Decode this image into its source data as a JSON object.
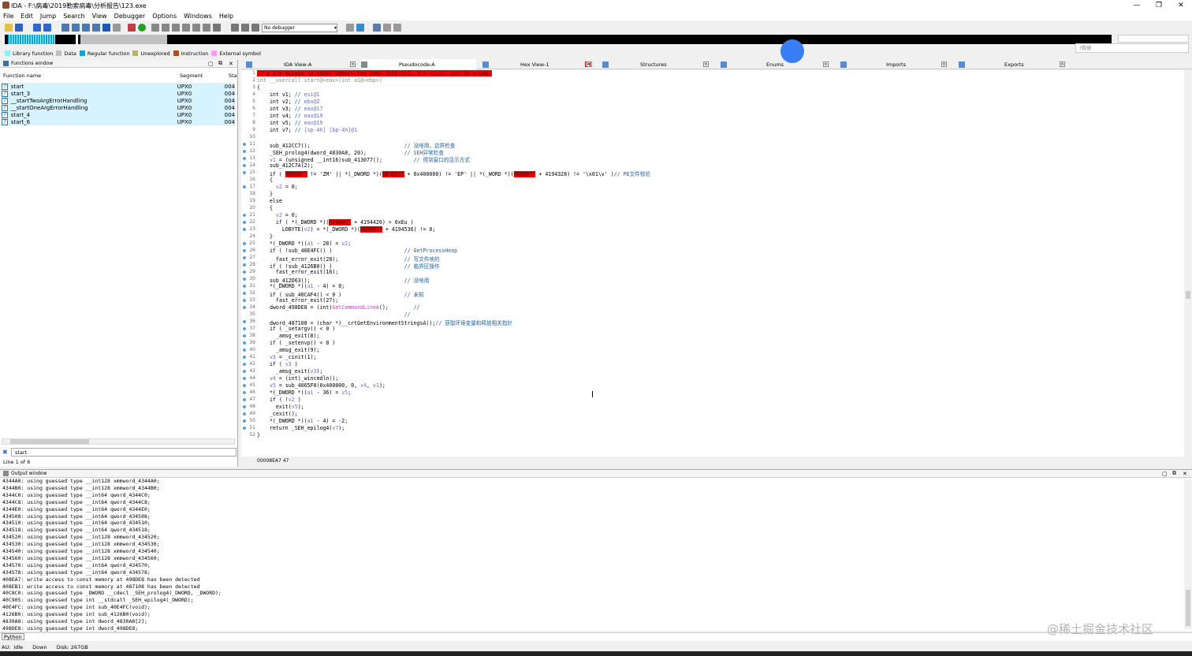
{
  "window": {
    "title": "IDA - F:\\病毒\\2019勒索病毒\\分析报告\\123.exe"
  },
  "menu": [
    "File",
    "Edit",
    "Jump",
    "Search",
    "View",
    "Debugger",
    "Options",
    "Windows",
    "Help"
  ],
  "toolbar": {
    "debugger_select": "No debugger"
  },
  "legend": [
    {
      "label": "Library function",
      "color": "#8ff0f0"
    },
    {
      "label": "Data",
      "color": "#c0c0c0"
    },
    {
      "label": "Regular function",
      "color": "#0aa5dc"
    },
    {
      "label": "Unexplored",
      "color": "#b4b478"
    },
    {
      "label": "Instruction",
      "color": "#a0522d"
    },
    {
      "label": "External symbol",
      "color": "#ff9ff0"
    }
  ],
  "popup_text": "?数据",
  "functions_window": {
    "title": "Functions window",
    "columns": [
      "Function name",
      "Segment",
      "Sta"
    ],
    "rows": [
      {
        "name": "start",
        "segment": "UPX0",
        "start": "004"
      },
      {
        "name": "start_3",
        "segment": "UPX0",
        "start": "004"
      },
      {
        "name": "__startTwoArgErrorHandling",
        "segment": "UPX0",
        "start": "004"
      },
      {
        "name": "__startOneArgErrorHandling",
        "segment": "UPX0",
        "start": "004"
      },
      {
        "name": "start_4",
        "segment": "UPX0",
        "start": "004"
      },
      {
        "name": "start_6",
        "segment": "UPX0",
        "start": "004"
      }
    ],
    "search_value": "start",
    "line_count": "Line 1 of 6"
  },
  "tabs": [
    "IDA View-A",
    "Pseudocode-A",
    "Hex View-1",
    "Structures",
    "Enums",
    "Imports",
    "Exports"
  ],
  "code": {
    "warning": "// write access to const memory has been detected, the output may be wrong!",
    "address": "00008EA7 47"
  },
  "output_window": {
    "title": "Output window",
    "lines": [
      "4344A0: using guessed type __int128 xmmword_4344A0;",
      "4344B0: using guessed type __int128 xmmword_4344B0;",
      "4344C0: using guessed type __int64 qword_4344C0;",
      "4344C8: using guessed type __int64 qword_4344C8;",
      "4344E0: using guessed type __int64 qword_4344E0;",
      "434508: using guessed type __int64 qword_434508;",
      "434510: using guessed type __int64 qword_434510;",
      "434518: using guessed type __int64 qword_434518;",
      "434520: using guessed type __int128 xmmword_434520;",
      "434530: using guessed type __int128 xmmword_434530;",
      "434540: using guessed type __int128 xmmword_434540;",
      "434560: using guessed type __int128 xmmword_434560;",
      "434570: using guessed type __int64 qword_434570;",
      "434578: using guessed type __int64 qword_434578;",
      "408EA7: write access to const memory at 498DE8 has been detected",
      "408EB1: write access to const memory at 487108 has been detected",
      "40C8C0: using guessed type _DWORD __cdecl _SEH_prolog4(_DWORD, _DWORD);",
      "40C905: using guessed type int __stdcall _SEH_epilog4(_DWORD);",
      "40E4FC: using guessed type int sub_40E4FC(void);",
      "4126B0: using guessed type int sub_4126B0(void);",
      "4830A8: using guessed type int dword_4830A8[2];",
      "498DE8: using guessed type int dword_498DE8;"
    ]
  },
  "python_label": "Python",
  "status": {
    "au": "AU:",
    "state": "idle",
    "direction": "Down",
    "disk": "Disk: 267GB"
  },
  "watermark": "@稀土掘金技术社区"
}
